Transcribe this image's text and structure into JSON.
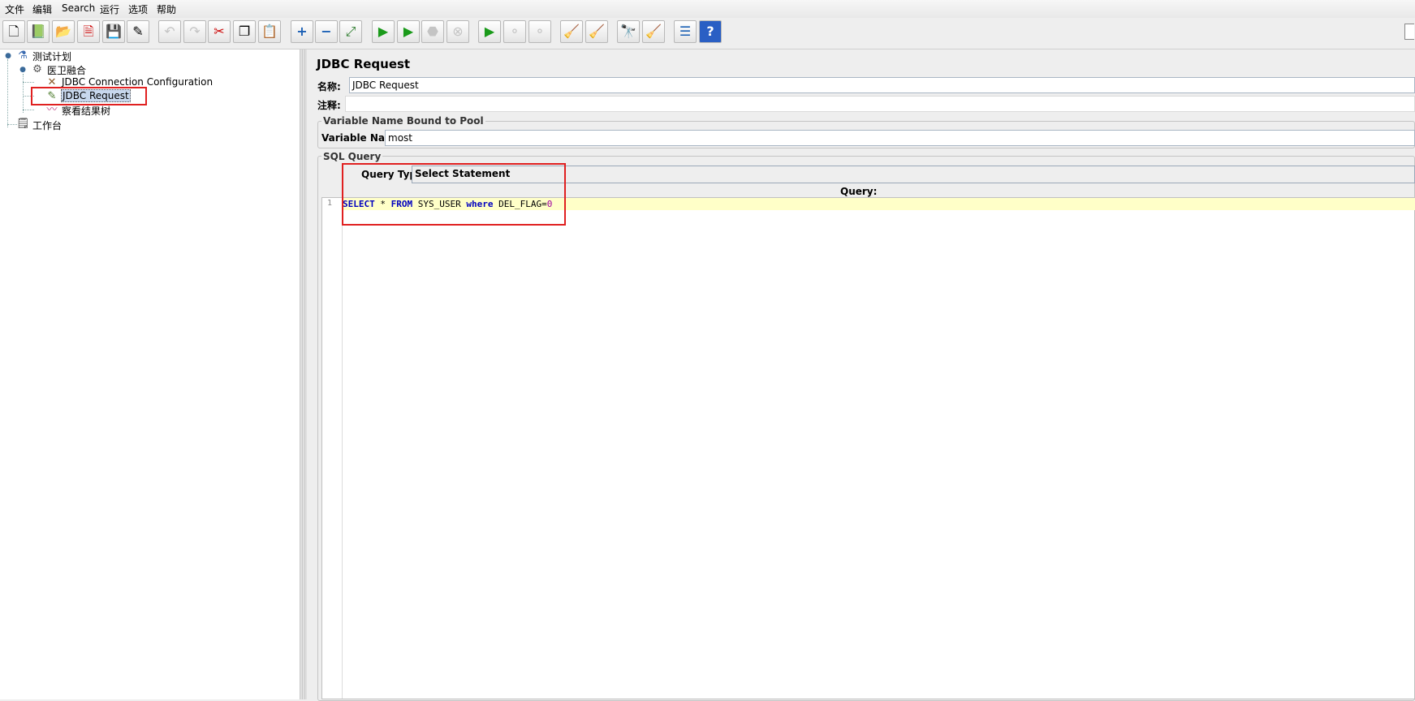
{
  "menubar": {
    "items": [
      "文件",
      "编辑",
      "Search",
      "运行",
      "选项",
      "帮助"
    ]
  },
  "toolbar": {
    "buttons": [
      {
        "name": "new-icon",
        "glyph": "🗋"
      },
      {
        "name": "templates-icon",
        "glyph": "📗"
      },
      {
        "name": "open-icon",
        "glyph": "📂"
      },
      {
        "name": "close-icon",
        "glyph": "🗎"
      },
      {
        "name": "save-icon",
        "glyph": "💾"
      },
      {
        "name": "save-as-icon",
        "glyph": "✎"
      },
      {
        "name": "undo-icon",
        "glyph": "↶"
      },
      {
        "name": "redo-icon",
        "glyph": "↷"
      },
      {
        "name": "cut-icon",
        "glyph": "✂"
      },
      {
        "name": "copy-icon",
        "glyph": "❐"
      },
      {
        "name": "paste-icon",
        "glyph": "📋"
      },
      {
        "name": "expand-icon",
        "glyph": "+"
      },
      {
        "name": "collapse-icon",
        "glyph": "−"
      },
      {
        "name": "toggle-icon",
        "glyph": "⤢"
      },
      {
        "name": "start-icon",
        "glyph": "▶"
      },
      {
        "name": "start-no-pause-icon",
        "glyph": "▶"
      },
      {
        "name": "stop-icon",
        "glyph": "⬣"
      },
      {
        "name": "shutdown-icon",
        "glyph": "⊗"
      },
      {
        "name": "remote-start-icon",
        "glyph": "▶"
      },
      {
        "name": "remote-stop-icon",
        "glyph": "⚬"
      },
      {
        "name": "remote-shutdown-icon",
        "glyph": "⚬"
      },
      {
        "name": "clear-icon",
        "glyph": "🧹"
      },
      {
        "name": "clear-all-icon",
        "glyph": "🧹"
      },
      {
        "name": "search-icon",
        "glyph": "🔭"
      },
      {
        "name": "reset-search-icon",
        "glyph": "🧹"
      },
      {
        "name": "function-helper-icon",
        "glyph": "☰"
      },
      {
        "name": "help-icon",
        "glyph": "?"
      }
    ]
  },
  "tree": {
    "test_plan": "测试计划",
    "thread_group": "医卫融合",
    "jdbc_config": "JDBC Connection Configuration",
    "jdbc_request": "JDBC Request",
    "result_tree": "察看结果树",
    "workbench": "工作台"
  },
  "panel": {
    "title": "JDBC Request",
    "name_label": "名称:",
    "name_value": "JDBC Request",
    "comment_label": "注释:",
    "comment_value": "",
    "pool_group_title": "Variable Name Bound to Pool",
    "variable_name_label": "Variable Name:",
    "variable_name_value": "most",
    "sql_group_title": "SQL Query",
    "query_type_label": "Query Type:",
    "query_type_value": "Select Statement",
    "query_header": "Query:",
    "editor": {
      "line_number": "1",
      "tokens": {
        "kw_select": "SELECT",
        "star": " * ",
        "kw_from": "FROM",
        "table": " SYS_USER ",
        "kw_where": "where",
        "column": " DEL_FLAG",
        "eq": "=",
        "num": "0"
      }
    }
  },
  "colors": {
    "highlight_line": "#ffffc8",
    "keyword": "#0000c0",
    "number": "#a000a0",
    "annotation_box": "#e02020",
    "selection": "#c8d8ee"
  }
}
